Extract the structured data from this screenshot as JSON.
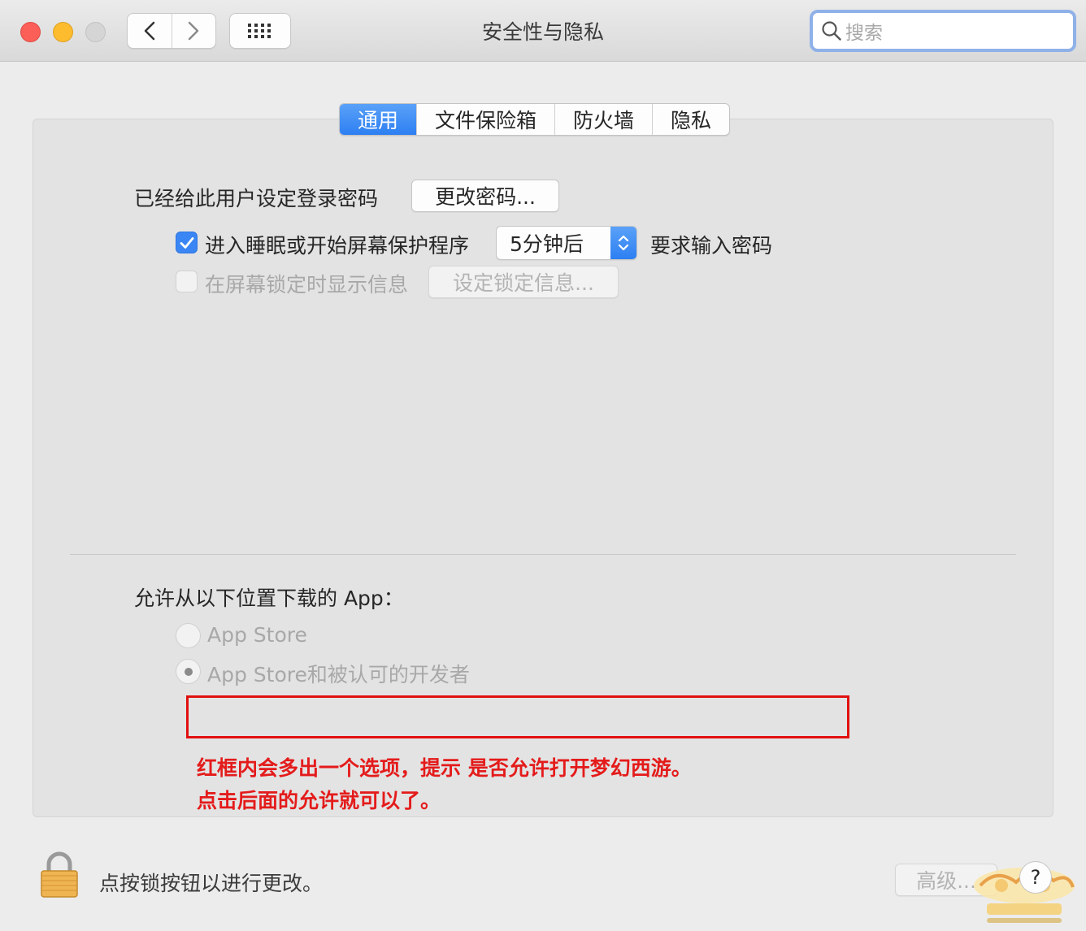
{
  "window": {
    "title": "安全性与隐私"
  },
  "toolbar": {
    "back_icon": "chevron-left-icon",
    "forward_icon": "chevron-right-icon",
    "grid_icon": "show-all-grid-icon"
  },
  "search": {
    "placeholder": "搜索",
    "icon": "search-icon"
  },
  "tabs": [
    {
      "label": "通用",
      "active": true
    },
    {
      "label": "文件保险箱",
      "active": false
    },
    {
      "label": "防火墙",
      "active": false
    },
    {
      "label": "隐私",
      "active": false
    }
  ],
  "general": {
    "password_label": "已经给此用户设定登录密码",
    "change_password_button": "更改密码...",
    "sleep_checkbox": {
      "label": "进入睡眠或开始屏幕保护程序",
      "checked": true
    },
    "sleep_delay_selected": "5分钟后",
    "require_password_label": "要求输入密码",
    "lock_message_checkbox": {
      "label": "在屏幕锁定时显示信息",
      "checked": false,
      "enabled": false
    },
    "set_lock_message_button": "设定锁定信息..."
  },
  "downloads": {
    "heading": "允许从以下位置下载的 App：",
    "options": [
      {
        "label": "App Store",
        "selected": false
      },
      {
        "label": "App Store和被认可的开发者",
        "selected": true
      }
    ]
  },
  "annotation": {
    "line1": "红框内会多出一个选项，提示 是否允许打开梦幻西游。",
    "line2": "点击后面的允许就可以了。"
  },
  "footer": {
    "lock_icon": "padlock-icon",
    "lock_text": "点按锁按钮以进行更改。",
    "advanced_button": "高级...",
    "help_button": "?"
  },
  "colors": {
    "accent": "#2d7ff2",
    "annotation_red": "#e11010",
    "traffic_close": "#fc5f57",
    "traffic_minimize": "#fdbc2e"
  }
}
